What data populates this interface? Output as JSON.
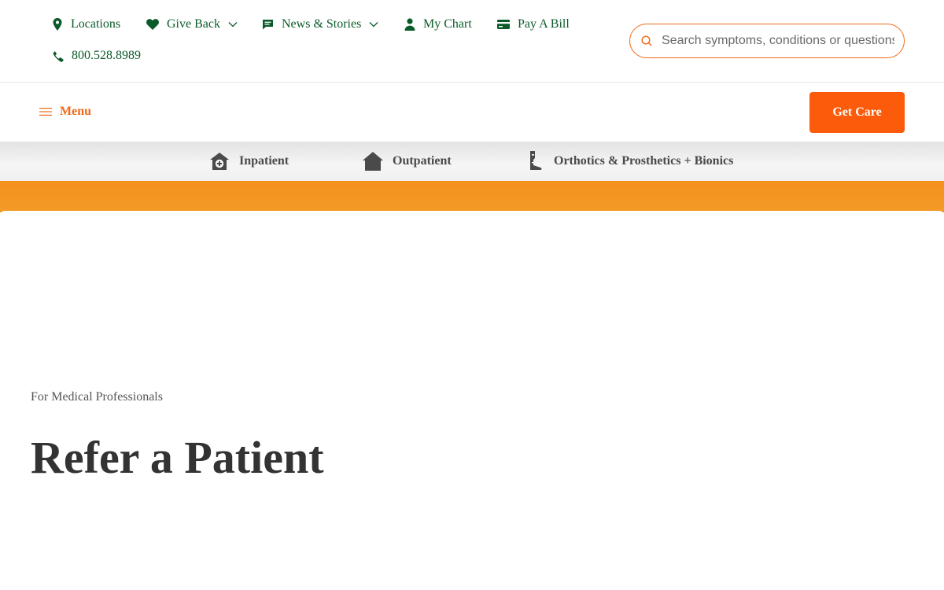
{
  "utility": {
    "locations": "Locations",
    "give_back": "Give Back",
    "news_stories": "News & Stories",
    "my_chart": "My Chart",
    "pay_bill": "Pay A Bill",
    "phone": "800.528.8989"
  },
  "search": {
    "placeholder": "Search symptoms, conditions or questions"
  },
  "nav": {
    "menu_label": "Menu",
    "get_care_label": "Get Care"
  },
  "services": [
    {
      "label": "Inpatient",
      "icon": "hospital-home-icon"
    },
    {
      "label": "Outpatient",
      "icon": "house-icon"
    },
    {
      "label": "Orthotics & Prosthetics + Bionics",
      "icon": "prosthetic-leg-icon"
    }
  ],
  "hero": {
    "eyebrow": "For Medical Professionals",
    "title": "Refer a Patient"
  },
  "colors": {
    "brand_green": "#0b5a2a",
    "brand_orange": "#f26a1b",
    "cta_orange": "#fb5b0a",
    "band_orange": "#f5911e"
  }
}
